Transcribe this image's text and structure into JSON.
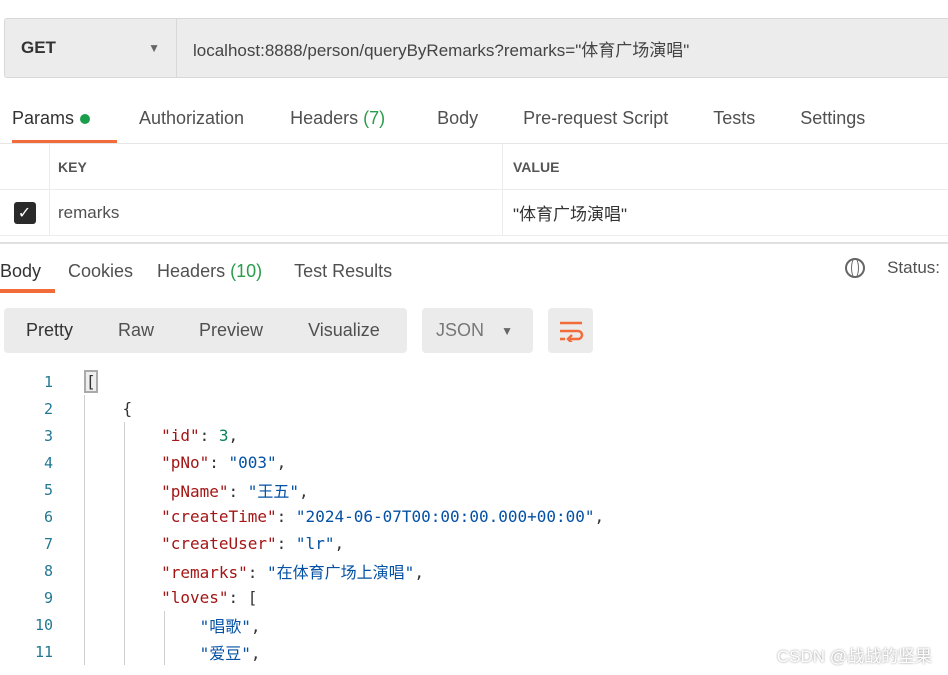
{
  "request": {
    "method": "GET",
    "url": "localhost:8888/person/queryByRemarks?remarks=\"体育广场演唱\""
  },
  "req_tabs": [
    {
      "label": "Params"
    },
    {
      "label": "Authorization"
    },
    {
      "label": "Headers",
      "count": "(7)"
    },
    {
      "label": "Body"
    },
    {
      "label": "Pre-request Script"
    },
    {
      "label": "Tests"
    },
    {
      "label": "Settings"
    }
  ],
  "params": {
    "key_header": "KEY",
    "value_header": "VALUE",
    "rows": [
      {
        "checked": true,
        "key": "remarks",
        "value": "\"体育广场演唱\""
      }
    ]
  },
  "resp_tabs": [
    {
      "label": "Body"
    },
    {
      "label": "Cookies"
    },
    {
      "label": "Headers",
      "count": "(10)"
    },
    {
      "label": "Test Results"
    }
  ],
  "status_label": "Status:",
  "view_modes": [
    "Pretty",
    "Raw",
    "Preview",
    "Visualize"
  ],
  "format": "JSON",
  "code_lines": [
    {
      "n": "1",
      "parts": [
        [
          "p",
          "["
        ]
      ]
    },
    {
      "n": "2",
      "parts": [
        [
          "p",
          "    {"
        ]
      ]
    },
    {
      "n": "3",
      "parts": [
        [
          "p",
          "        "
        ],
        [
          "k",
          "\"id\""
        ],
        [
          "p",
          ": "
        ],
        [
          "n",
          "3"
        ],
        [
          "p",
          ","
        ]
      ]
    },
    {
      "n": "4",
      "parts": [
        [
          "p",
          "        "
        ],
        [
          "k",
          "\"pNo\""
        ],
        [
          "p",
          ": "
        ],
        [
          "s",
          "\"003\""
        ],
        [
          "p",
          ","
        ]
      ]
    },
    {
      "n": "5",
      "parts": [
        [
          "p",
          "        "
        ],
        [
          "k",
          "\"pName\""
        ],
        [
          "p",
          ": "
        ],
        [
          "s",
          "\"王五\""
        ],
        [
          "p",
          ","
        ]
      ]
    },
    {
      "n": "6",
      "parts": [
        [
          "p",
          "        "
        ],
        [
          "k",
          "\"createTime\""
        ],
        [
          "p",
          ": "
        ],
        [
          "s",
          "\"2024-06-07T00:00:00.000+00:00\""
        ],
        [
          "p",
          ","
        ]
      ]
    },
    {
      "n": "7",
      "parts": [
        [
          "p",
          "        "
        ],
        [
          "k",
          "\"createUser\""
        ],
        [
          "p",
          ": "
        ],
        [
          "s",
          "\"lr\""
        ],
        [
          "p",
          ","
        ]
      ]
    },
    {
      "n": "8",
      "parts": [
        [
          "p",
          "        "
        ],
        [
          "k",
          "\"remarks\""
        ],
        [
          "p",
          ": "
        ],
        [
          "s",
          "\"在体育广场上演唱\""
        ],
        [
          "p",
          ","
        ]
      ]
    },
    {
      "n": "9",
      "parts": [
        [
          "p",
          "        "
        ],
        [
          "k",
          "\"loves\""
        ],
        [
          "p",
          ": ["
        ]
      ]
    },
    {
      "n": "10",
      "parts": [
        [
          "p",
          "            "
        ],
        [
          "s",
          "\"唱歌\""
        ],
        [
          "p",
          ","
        ]
      ]
    },
    {
      "n": "11",
      "parts": [
        [
          "p",
          "            "
        ],
        [
          "s",
          "\"爱豆\""
        ],
        [
          "p",
          ","
        ]
      ]
    }
  ],
  "watermark": "CSDN @战战的坚果"
}
